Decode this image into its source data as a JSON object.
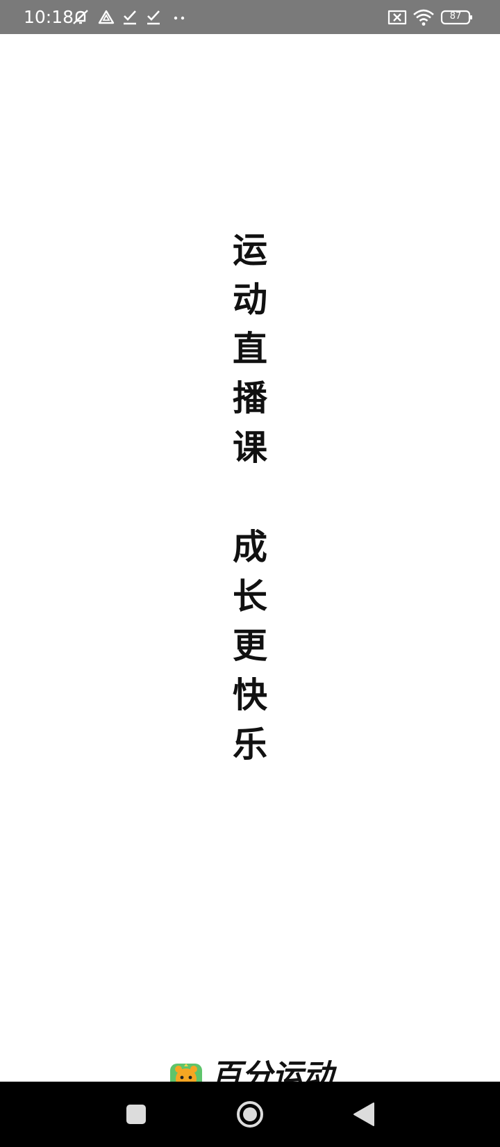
{
  "status_bar": {
    "time": "10:18",
    "battery_level": "87",
    "icons": [
      "muted-bell-icon",
      "alert-triangle-icon",
      "check-download-icon",
      "check-download-icon",
      "more-dots-icon",
      "sim-x-icon",
      "wifi-icon",
      "battery-icon"
    ]
  },
  "splash": {
    "slogan_line_1": [
      "运",
      "动",
      "直",
      "播",
      "课"
    ],
    "slogan_line_2": [
      "成",
      "长",
      "更",
      "快",
      "乐"
    ],
    "brand_name": "百分运动",
    "brand_logo": "tiger-mascot-logo"
  },
  "nav_bar": {
    "buttons": [
      "recents-square-icon",
      "home-circle-icon",
      "back-triangle-icon"
    ]
  },
  "colors": {
    "status_bar_bg": "#7a7a7a",
    "background": "#ffffff",
    "text": "#111111",
    "nav_bar_bg": "#000000",
    "nav_icon": "#dcdcdc",
    "logo_green": "#5ec46b",
    "logo_orange": "#f5a623"
  }
}
